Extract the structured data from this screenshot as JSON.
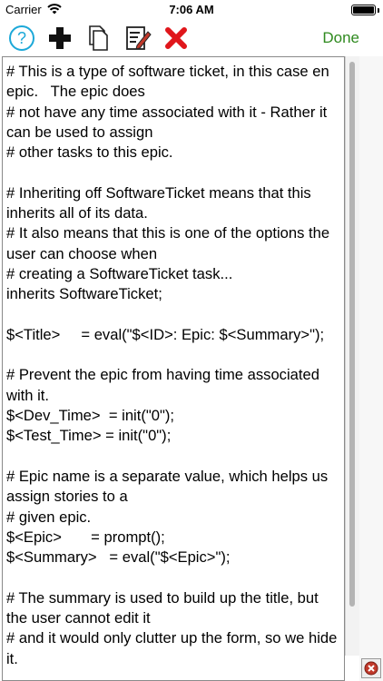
{
  "status_bar": {
    "carrier": "Carrier",
    "time": "7:06 AM"
  },
  "toolbar": {
    "done_label": "Done",
    "icons": [
      "help-icon",
      "add-icon",
      "copy-icon",
      "edit-icon",
      "delete-icon"
    ]
  },
  "colors": {
    "done": "#2f8a1f",
    "help": "#1ca8d8",
    "delete": "#e0161b"
  },
  "editor": {
    "text": "# This is a type of software ticket, in this case en epic.   The epic does\n# not have any time associated with it - Rather it can be used to assign\n# other tasks to this epic.\n\n# Inheriting off SoftwareTicket means that this inherits all of its data.\n# It also means that this is one of the options the user can choose when\n# creating a SoftwareTicket task...\ninherits SoftwareTicket;\n\n$<Title>     = eval(\"$<ID>: Epic: $<Summary>\");\n\n# Prevent the epic from having time associated with it.\n$<Dev_Time>  = init(\"0\");\n$<Test_Time> = init(\"0\");\n\n# Epic name is a separate value, which helps us assign stories to a\n# given epic.\n$<Epic>       = prompt();\n$<Summary>   = eval(\"$<Epic>\");\n\n# The summary is used to build up the title, but the user cannot edit it\n# and it would only clutter up the form, so we hide it."
  }
}
